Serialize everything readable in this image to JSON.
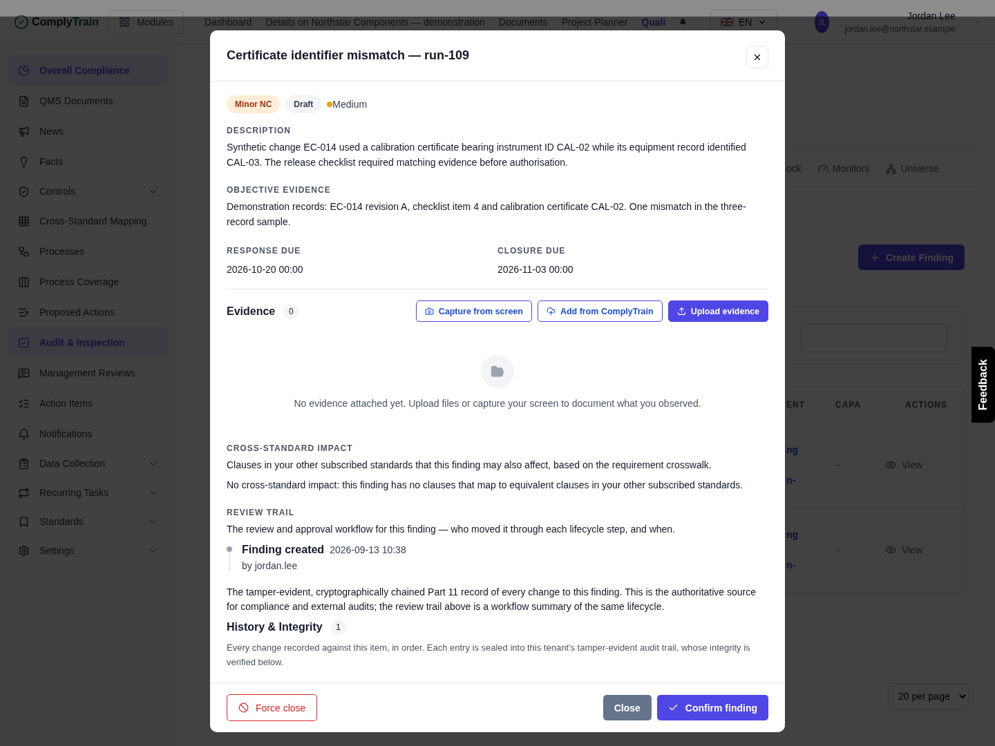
{
  "topbar": {
    "brand": [
      "Comply",
      "Train"
    ],
    "modules": "Modules",
    "nav": [
      {
        "label": "Dashboard",
        "selected": false
      },
      {
        "label": "Details on Northstar Components — demonstration",
        "selected": false
      },
      {
        "label": "Documents",
        "selected": false
      },
      {
        "label": "Project Planner",
        "selected": false
      },
      {
        "label": "Quali",
        "selected": true
      }
    ],
    "language": "EN",
    "user": {
      "initials": "JL",
      "name": "Jordan Lee",
      "email": "jordan.lee@northstar.example"
    }
  },
  "sidebar": {
    "items": [
      {
        "label": "Overall Compliance",
        "selected": true,
        "expandable": false
      },
      {
        "label": "QMS Documents",
        "selected": false,
        "expandable": false
      },
      {
        "label": "News",
        "selected": false,
        "expandable": false
      },
      {
        "label": "Facts",
        "selected": false,
        "expandable": false
      },
      {
        "label": "Controls",
        "selected": false,
        "expandable": true
      },
      {
        "label": "Cross-Standard Mapping",
        "selected": false,
        "expandable": false
      },
      {
        "label": "Processes",
        "selected": false,
        "expandable": false
      },
      {
        "label": "Process Coverage",
        "selected": false,
        "expandable": false
      },
      {
        "label": "Proposed Actions",
        "selected": false,
        "expandable": false
      },
      {
        "label": "Audit & Inspection",
        "selected": true,
        "expandable": false
      },
      {
        "label": "Management Reviews",
        "selected": false,
        "expandable": false
      },
      {
        "label": "Action Items",
        "selected": false,
        "expandable": false
      },
      {
        "label": "Notifications",
        "selected": false,
        "expandable": false
      },
      {
        "label": "Data Collection",
        "selected": false,
        "expandable": true
      },
      {
        "label": "Recurring Tasks",
        "selected": false,
        "expandable": true
      },
      {
        "label": "Standards",
        "selected": false,
        "expandable": true
      },
      {
        "label": "Settings",
        "selected": false,
        "expandable": true
      }
    ]
  },
  "page": {
    "tabs": [
      "ock",
      "Monitors",
      "Universe"
    ],
    "create_button": "Create Finding",
    "table": {
      "columns": [
        "ENT",
        "CAPA",
        "ACTIONS"
      ],
      "rows": [
        {
          "column_1": [
            "ng",
            "n-"
          ],
          "capa": "-",
          "action": "View"
        },
        {
          "column_1": [
            "ng",
            "n-"
          ],
          "capa": "-",
          "action": "View"
        }
      ]
    },
    "page_size": "20 per page"
  },
  "feedback": "Feedback",
  "modal": {
    "title": "Certificate identifier mismatch — run-109",
    "badges": [
      {
        "label": "Minor NC",
        "kind": "severity"
      },
      {
        "label": "Draft",
        "kind": "status"
      }
    ],
    "priority": {
      "label": "Medium",
      "color": "#f59e0b"
    },
    "fields": [
      {
        "label": "DESCRIPTION",
        "value": "Synthetic change EC-014 used a calibration certificate bearing instrument ID CAL-02 while its equipment record identified CAL-03. The release checklist required matching evidence before authorisation."
      },
      {
        "label": "OBJECTIVE EVIDENCE",
        "value": "Demonstration records: EC-014 revision A, checklist item 4 and calibration certificate CAL-02. One mismatch in the three-record sample."
      }
    ],
    "dates": [
      {
        "label": "RESPONSE DUE",
        "value": "2026-10-20 00:00"
      },
      {
        "label": "CLOSURE DUE",
        "value": "2026-11-03 00:00"
      }
    ],
    "evidence": {
      "title": "Evidence",
      "count": "0",
      "buttons": [
        {
          "label": "Capture from screen",
          "kind": "outline"
        },
        {
          "label": "Add from ComplyTrain",
          "kind": "outline"
        },
        {
          "label": "Upload evidence",
          "kind": "primary"
        }
      ],
      "empty": "No evidence attached yet. Upload files or capture your screen to document what you observed."
    },
    "cross_standard": {
      "label": "CROSS-STANDARD IMPACT",
      "intro": "Clauses in your other subscribed standards that this finding may also affect, based on the requirement crosswalk.",
      "note": "No cross-standard impact: this finding has no clauses that map to equivalent clauses in your other subscribed standards."
    },
    "review_trail": {
      "label": "REVIEW TRAIL",
      "intro": "The review and approval workflow for this finding — who moved it through each lifecycle step, and when.",
      "entries": [
        {
          "title": "Finding created",
          "time": "2026-09-13 10:38",
          "by": "by jordan.lee"
        }
      ]
    },
    "history": {
      "intro": "The tamper-evident, cryptographically chained Part 11 record of every change to this finding. This is the authoritative source for compliance and external audits; the review trail above is a workflow summary of the same lifecycle.",
      "title": "History & Integrity",
      "count": "1",
      "note": "Every change recorded against this item, in order. Each entry is sealed into this tenant's tamper-evident audit trail, whose integrity is verified below."
    },
    "footer": {
      "force_close": "Force close",
      "close": "Close",
      "confirm": "Confirm finding"
    }
  }
}
